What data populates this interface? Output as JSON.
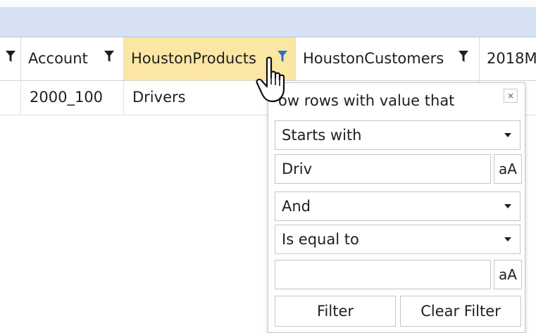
{
  "grid": {
    "columns": [
      {
        "label": "Account"
      },
      {
        "label": "HoustonProducts"
      },
      {
        "label": "HoustonCustomers"
      },
      {
        "label": "2018M"
      }
    ],
    "row": {
      "account": "2000_100",
      "houston_products": "Drivers"
    }
  },
  "filter_popup": {
    "title": "ow rows with value that",
    "close_glyph": "×",
    "operator1": "Starts with",
    "value1": "Driv",
    "case1": "aA",
    "logic": "And",
    "operator2": "Is equal to",
    "value2": "",
    "case2": "aA",
    "filter_label": "Filter",
    "clear_label": "Clear Filter"
  },
  "icons": [
    "filter-funnel-icon",
    "hand-pointer-cursor-icon",
    "close-icon",
    "dropdown-caret-icon"
  ],
  "colors": {
    "group_band": "#d6e1f3",
    "active_header": "#fbe7a3",
    "active_funnel": "#2a6fc9"
  }
}
